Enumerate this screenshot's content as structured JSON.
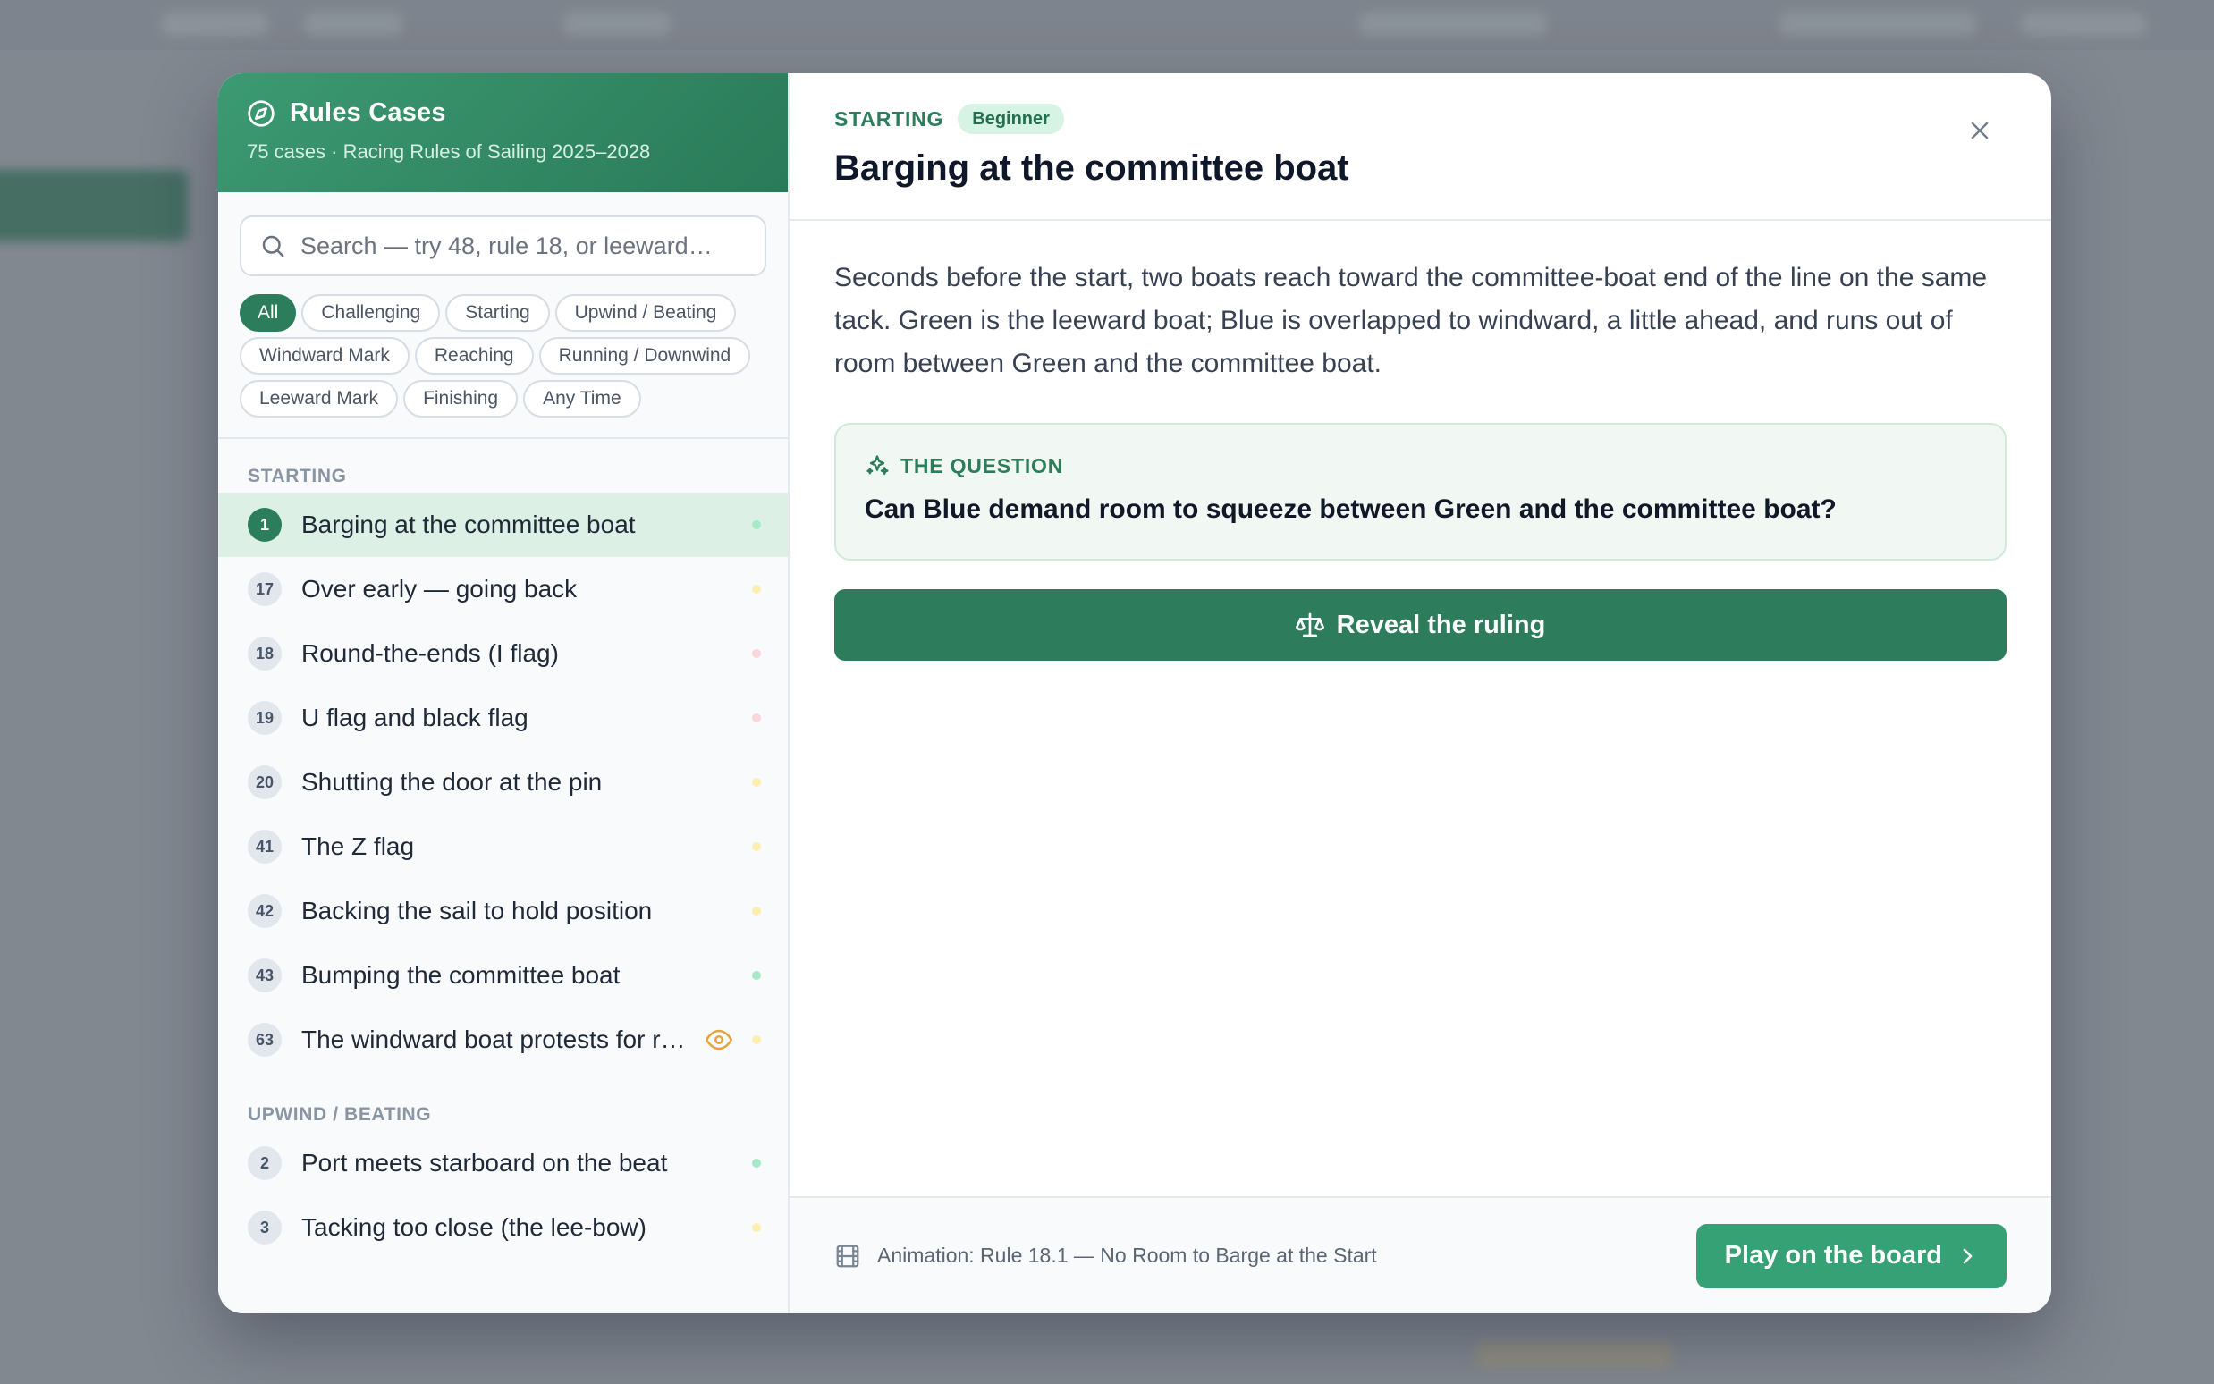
{
  "sidebar": {
    "title": "Rules Cases",
    "subtitle": "75 cases · Racing Rules of Sailing 2025–2028",
    "search_placeholder": "Search — try 48, rule 18, or leeward…",
    "filters": [
      {
        "label": "All",
        "active": true
      },
      {
        "label": "Challenging",
        "active": false
      },
      {
        "label": "Starting",
        "active": false
      },
      {
        "label": "Upwind / Beating",
        "active": false
      },
      {
        "label": "Windward Mark",
        "active": false
      },
      {
        "label": "Reaching",
        "active": false
      },
      {
        "label": "Running / Downwind",
        "active": false
      },
      {
        "label": "Leeward Mark",
        "active": false
      },
      {
        "label": "Finishing",
        "active": false
      },
      {
        "label": "Any Time",
        "active": false
      }
    ],
    "groups": [
      {
        "label": "STARTING",
        "cases": [
          {
            "num": "1",
            "title": "Barging at the committee boat",
            "dot": "#a7e8c8",
            "selected": true
          },
          {
            "num": "17",
            "title": "Over early — going back",
            "dot": "#fdeeb0"
          },
          {
            "num": "18",
            "title": "Round-the-ends (I flag)",
            "dot": "#fbd5d9"
          },
          {
            "num": "19",
            "title": "U flag and black flag",
            "dot": "#fbd5d9"
          },
          {
            "num": "20",
            "title": "Shutting the door at the pin",
            "dot": "#fdeeb0"
          },
          {
            "num": "41",
            "title": "The Z flag",
            "dot": "#fdeeb0"
          },
          {
            "num": "42",
            "title": "Backing the sail to hold position",
            "dot": "#fdeeb0"
          },
          {
            "num": "43",
            "title": "Bumping the committee boat",
            "dot": "#a7e8c8"
          },
          {
            "num": "63",
            "title": "The windward boat protests for room",
            "dot": "#fdeeb0",
            "eye": true
          }
        ]
      },
      {
        "label": "UPWIND / BEATING",
        "cases": [
          {
            "num": "2",
            "title": "Port meets starboard on the beat",
            "dot": "#a7e8c8"
          },
          {
            "num": "3",
            "title": "Tacking too close (the lee-bow)",
            "dot": "#fdeeb0"
          }
        ]
      }
    ]
  },
  "case": {
    "category": "STARTING",
    "level": "Beginner",
    "title": "Barging at the committee boat",
    "scenario": "Seconds before the start, two boats reach toward the committee-boat end of the line on the same tack. Green is the leeward boat; Blue is overlapped to windward, a little ahead, and runs out of room between Green and the committee boat.",
    "question_label": "THE QUESTION",
    "question": "Can Blue demand room to squeeze between Green and the committee boat?",
    "reveal_label": "Reveal the ruling"
  },
  "footer": {
    "animation_text": "Animation: Rule 18.1 — No Room to Barge at the Start",
    "play_label": "Play on the board"
  },
  "colors": {
    "brand": "#2b7d5b",
    "brand_light": "#36a175",
    "selected_row": "#dcf0e6",
    "eye_icon": "#e6a23c"
  }
}
